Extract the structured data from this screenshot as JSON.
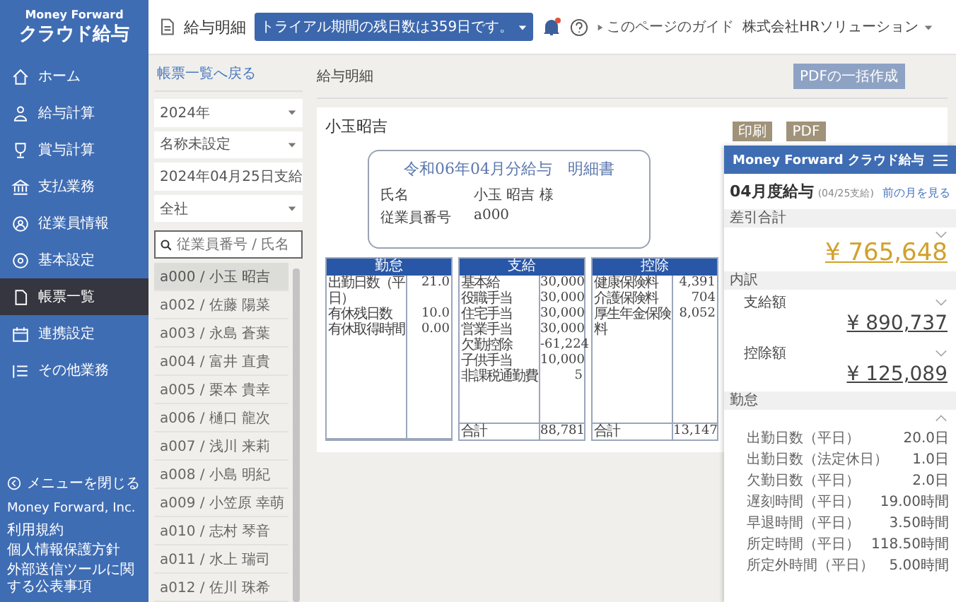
{
  "sidebar": {
    "logo": {
      "brand": "Money Forward",
      "product": "クラウド給与"
    },
    "items": [
      {
        "label": "ホーム",
        "selected": false
      },
      {
        "label": "給与計算",
        "selected": false
      },
      {
        "label": "賞与計算",
        "selected": false
      },
      {
        "label": "支払業務",
        "selected": false
      },
      {
        "label": "従業員情報",
        "selected": false
      },
      {
        "label": "基本設定",
        "selected": false
      },
      {
        "label": "帳票一覧",
        "selected": true
      },
      {
        "label": "連携設定",
        "selected": false
      },
      {
        "label": "その他業務",
        "selected": false
      }
    ],
    "footer": {
      "collapse": "メニューを閉じる",
      "company": "Money Forward, Inc.",
      "links": [
        "利用規約",
        "個人情報保護方針",
        "外部送信ツールに関する公表事項"
      ]
    }
  },
  "header": {
    "page_title": "給与明細",
    "trial_notice": "トライアル期間の残日数は359日です。",
    "notification_dot": true,
    "guide_link": "このページのガイド",
    "company": "株式会社HRソリューション"
  },
  "list_panel": {
    "back_link": "帳票一覧へ戻る",
    "filters": [
      "2024年",
      "名称未設定",
      "2024年04月25日支給",
      "全社"
    ],
    "search": {
      "placeholder": "従業員番号 / 氏名"
    },
    "employees": [
      {
        "label": "a000 / 小玉 昭吉",
        "selected": true
      },
      {
        "label": "a002 / 佐藤 陽菜",
        "selected": false
      },
      {
        "label": "a003 / 永島 蒼葉",
        "selected": false
      },
      {
        "label": "a004 / 富井 直貴",
        "selected": false
      },
      {
        "label": "a005 / 栗本 貴幸",
        "selected": false
      },
      {
        "label": "a006 / 樋口 龍次",
        "selected": false
      },
      {
        "label": "a007 / 浅川 来莉",
        "selected": false
      },
      {
        "label": "a008 / 小島 明紀",
        "selected": false
      },
      {
        "label": "a009 / 小笠原 幸萌",
        "selected": false
      },
      {
        "label": "a010 / 志村 琴音",
        "selected": false
      },
      {
        "label": "a011 / 水上 瑞司",
        "selected": false
      },
      {
        "label": "a012 / 佐川 珠希",
        "selected": false
      }
    ]
  },
  "main": {
    "title": "給与明細",
    "bulk_button": "PDFの一括作成",
    "employee_name": "小玉昭吉",
    "output_buttons": [
      "印刷",
      "PDF"
    ],
    "payslip": {
      "title": "令和06年04月分給与　明細書",
      "fields": [
        {
          "label": "氏名",
          "value": "小玉 昭吉 様"
        },
        {
          "label": "従業員番号",
          "value": "a000"
        }
      ],
      "sections": [
        {
          "title": "勤怠",
          "rows": [
            {
              "label": "出勤日数（平日）",
              "value": "21.0"
            },
            {
              "label": "有休残日数",
              "value": "10.0"
            },
            {
              "label": "有休取得時間",
              "value": "0.00"
            }
          ]
        },
        {
          "title": "支給",
          "rows": [
            {
              "label": "基本給",
              "value": "30,000"
            },
            {
              "label": "役職手当",
              "value": "30,000"
            },
            {
              "label": "住宅手当",
              "value": "30,000"
            },
            {
              "label": "営業手当",
              "value": "30,000"
            },
            {
              "label": "欠勤控除",
              "value": "-61,224"
            },
            {
              "label": "子供手当",
              "value": "10,000"
            },
            {
              "label": "非課税通勤費",
              "value": "5"
            }
          ],
          "total": {
            "label": "合計",
            "value": "88,781"
          }
        },
        {
          "title": "控除",
          "rows": [
            {
              "label": "健康保険料",
              "value": "4,391"
            },
            {
              "label": "介護保険料",
              "value": "704"
            },
            {
              "label": "厚生年金保険料",
              "value": "8,052"
            }
          ],
          "total": {
            "label": "合計",
            "value": "13,147"
          }
        }
      ]
    }
  },
  "mobile_preview": {
    "brand": "Money Forward クラウド給与",
    "month_title": "04月度給与",
    "pay_date": "(04/25支給)",
    "prev_link": "前の月を見る",
    "net_label": "差引合計",
    "net_amount": "¥ 765,648",
    "breakdown_label": "内訳",
    "breakdown": [
      {
        "label": "支給額",
        "amount": "¥ 890,737"
      },
      {
        "label": "控除額",
        "amount": "¥ 125,089"
      }
    ],
    "attendance_label": "勤怠",
    "attendance": [
      {
        "label": "出勤日数（平日）",
        "value": "20.0日"
      },
      {
        "label": "出勤日数（法定休日）",
        "value": "1.0日"
      },
      {
        "label": "欠勤日数（平日）",
        "value": "2.0日"
      },
      {
        "label": "遅刻時間（平日）",
        "value": "19.00時間"
      },
      {
        "label": "早退時間（平日）",
        "value": "3.50時間"
      },
      {
        "label": "所定時間（平日）",
        "value": "118.50時間"
      },
      {
        "label": "所定外時間（平日）",
        "value": "5.00時間"
      }
    ]
  }
}
